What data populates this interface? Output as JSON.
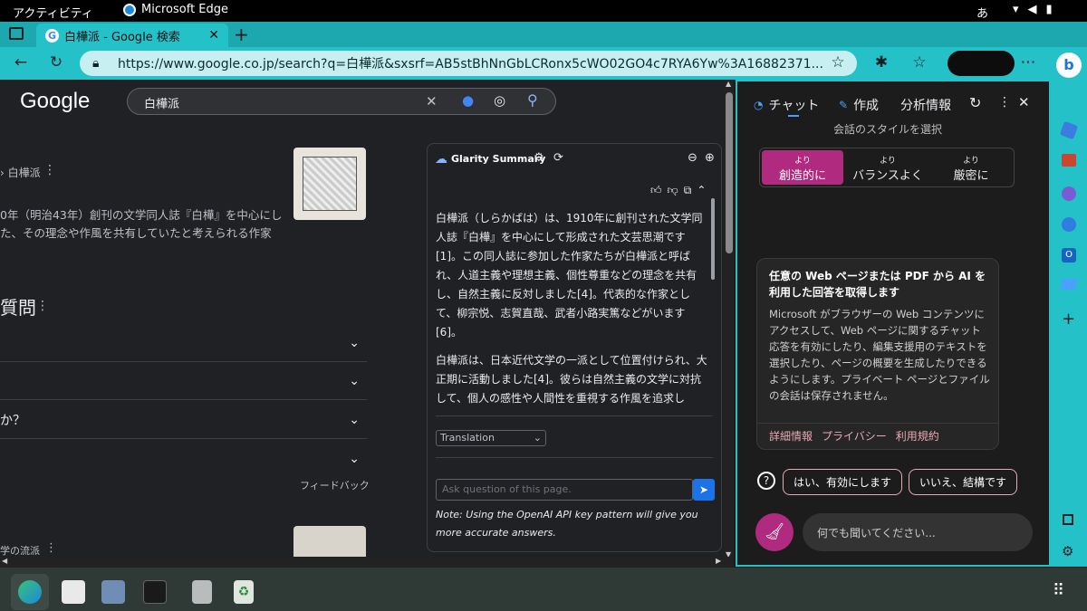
{
  "system": {
    "activities": "アクティビティ",
    "app_name": "Microsoft Edge",
    "ime": "あ"
  },
  "tab": {
    "title": "白樺派 - Google 検索"
  },
  "address": {
    "url": "https://www.google.co.jp/search?q=白樺派&sxsrf=AB5stBhNnGbLCRonx5cWO02GO4c7RYA6Yw%3A16882371..."
  },
  "google": {
    "logo": "Google",
    "query": "白樺派",
    "breadcrumb": "› 白樺派",
    "snippet_line1": "0年（明治43年）創刊の文学同人誌『白樺』を中心にし",
    "snippet_line2": "た、その理念や作風を共有していたと考えられる作家",
    "faq_heading": "質問",
    "faq_rows": [
      "",
      "",
      "か？",
      ""
    ],
    "feedback": "フィードバック",
    "result2_crumb": "学の流派"
  },
  "glarity": {
    "title": "Glarity Summary",
    "paragraph1": "白樺派（しらかばは）は、1910年に創刊された文学同人誌『白樺』を中心にして形成された文芸思潮です[1]。この同人誌に参加した作家たちが白樺派と呼ばれ、人道主義や理想主義、個性尊重などの理念を共有し、自然主義に反対しました[4]。代表的な作家として、柳宗悦、志賀直哉、武者小路実篤などがいます[6]。",
    "paragraph2": "白樺派は、日本近代文学の一派として位置付けられ、大正期に活動しました[4]。彼らは自然主義の文学に対抗して、個人の感性や人間性を重視する作風を追求し",
    "translation_select": "Translation",
    "ask_placeholder": "Ask question of this page.",
    "note": "Note: Using the OpenAI API key pattern will give you more accurate answers."
  },
  "chat": {
    "tabs": [
      "チャット",
      "作成",
      "分析情報"
    ],
    "style_heading": "会話のスタイルを選択",
    "styles": [
      {
        "small": "より",
        "label": "創造的に"
      },
      {
        "small": "より",
        "label": "バランスよく"
      },
      {
        "small": "より",
        "label": "厳密に"
      }
    ],
    "card_title": "任意の Web ページまたは PDF から AI を利用した回答を取得します",
    "card_body": "Microsoft がブラウザーの Web コンテンツにアクセスして、Web ページに関するチャット応答を有効にしたり、編集支援用のテキストを選択したり、ページの概要を生成したりできるようにします。プライベート ページとファイルの会話は保存されません。",
    "links": [
      "詳細情報",
      "プライバシー",
      "利用規約"
    ],
    "yes_button": "はい、有効にします",
    "no_button": "いいえ、結構です",
    "input_placeholder": "何でも聞いてください..."
  },
  "colors": {
    "accent": "#25c1c9",
    "creative": "#b02b7f"
  }
}
